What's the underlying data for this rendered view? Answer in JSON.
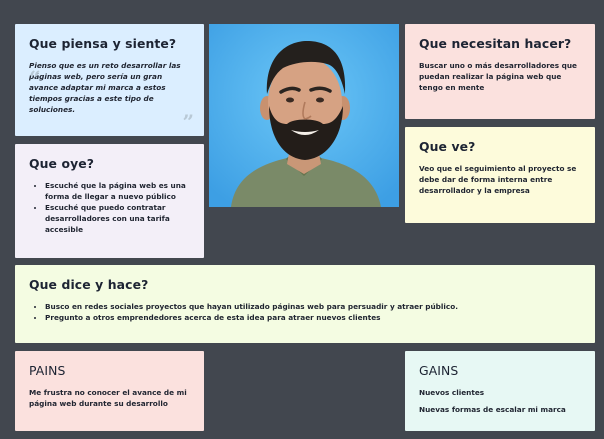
{
  "piensa": {
    "title": "Que piensa y siente?",
    "quote": "Pienso que es un reto desarrollar las páginas web, pero sería un gran avance adaptar mi marca a estos tiempos gracias a este tipo de soluciones."
  },
  "oye": {
    "title": "Que oye?",
    "items": [
      "Escuché que la página web es una forma de llegar a nuevo público",
      "Escuché que puedo contratar desarrolladores con una tarifa accesible"
    ]
  },
  "necesitan": {
    "title": "Que necesitan hacer?",
    "text": "Buscar uno o más desarrolladores que puedan realizar la página web que tengo en mente"
  },
  "ve": {
    "title": "Que ve?",
    "text": "Veo que el seguimiento al proyecto se debe dar de forma interna entre desarrollador y la empresa"
  },
  "dice": {
    "title": "Que dice y hace?",
    "items": [
      "Busco en redes sociales proyectos que hayan utilizado páginas web para persuadir y atraer público.",
      "Pregunto a otros emprendedores acerca de esta idea para atraer nuevos clientes"
    ]
  },
  "pains": {
    "title": "PAINS",
    "text": "Me frustra no conocer el avance de mi página web durante su desarrollo"
  },
  "gains": {
    "title": "GAINS",
    "items": [
      "Nuevos clientes",
      "Nuevas formas de escalar mi marca"
    ]
  },
  "colors": {
    "background": "#42474f",
    "piensa": "#dbeeff",
    "oye": "#f3eff8",
    "necesitan": "#fbe1de",
    "ve": "#fdfbdb",
    "dice": "#f4fce2",
    "pains": "#fbe1de",
    "gains": "#e7f8f4",
    "portrait_bg": "#4fb0ee"
  }
}
